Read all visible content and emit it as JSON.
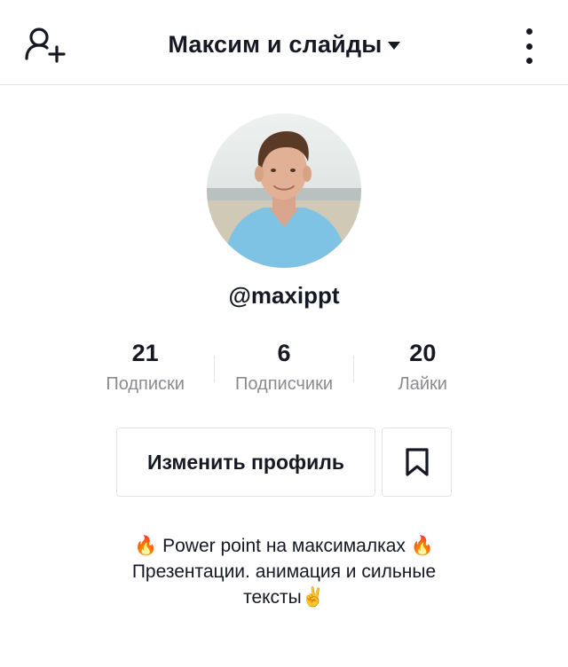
{
  "header": {
    "title": "Максим и слайды",
    "add_user_icon": "add-user-icon",
    "caret_icon": "caret-down-icon",
    "more_icon": "more-vertical-icon"
  },
  "profile": {
    "username": "@maxippt",
    "avatar": "avatar-photo"
  },
  "stats": [
    {
      "value": "21",
      "label": "Подписки"
    },
    {
      "value": "6",
      "label": "Подписчики"
    },
    {
      "value": "20",
      "label": "Лайки"
    }
  ],
  "actions": {
    "edit_profile": "Изменить профиль",
    "bookmark_icon": "bookmark-icon"
  },
  "bio": {
    "line1": "🔥 Power point на максималках 🔥",
    "line2": "Презентации. анимация и сильные",
    "line3": "тексты✌️"
  },
  "colors": {
    "text": "#161823",
    "muted": "#8a8b91",
    "border": "#e3e3e4"
  }
}
